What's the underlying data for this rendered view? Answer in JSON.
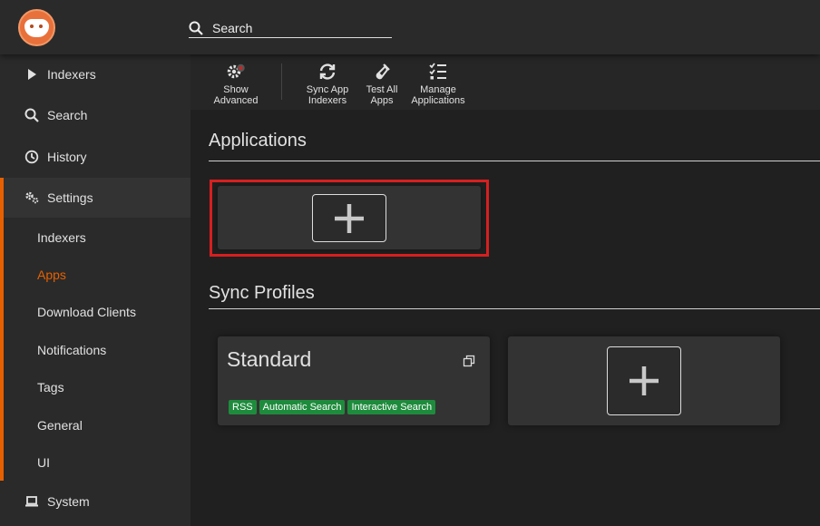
{
  "header": {
    "logo": "prowlarr-logo",
    "search_icon": "search-icon",
    "search_placeholder": "Search"
  },
  "sidebar": {
    "items": [
      {
        "label": "Indexers",
        "icon": "play-icon"
      },
      {
        "label": "Search",
        "icon": "search-icon"
      },
      {
        "label": "History",
        "icon": "clock-icon"
      },
      {
        "label": "Settings",
        "icon": "gears-icon"
      },
      {
        "label": "System",
        "icon": "laptop-icon"
      }
    ],
    "settings_sub": [
      "Indexers",
      "Apps",
      "Download Clients",
      "Notifications",
      "Tags",
      "General",
      "UI"
    ],
    "active_sub": "Apps",
    "accent_color": "#e66000"
  },
  "toolbar": {
    "show_advanced": {
      "line1": "Show",
      "line2": "Advanced"
    },
    "sync_app_indexers": {
      "line1": "Sync App",
      "line2": "Indexers"
    },
    "test_all_apps": {
      "line1": "Test All",
      "line2": "Apps"
    },
    "manage_applications": {
      "line1": "Manage",
      "line2": "Applications"
    }
  },
  "applications": {
    "title": "Applications"
  },
  "sync_profiles": {
    "title": "Sync Profiles",
    "profiles": [
      {
        "name": "Standard",
        "tags": [
          "RSS",
          "Automatic Search",
          "Interactive Search"
        ]
      }
    ],
    "tag_color": "#1e8b3c"
  },
  "highlight_color": "#d71f1f"
}
